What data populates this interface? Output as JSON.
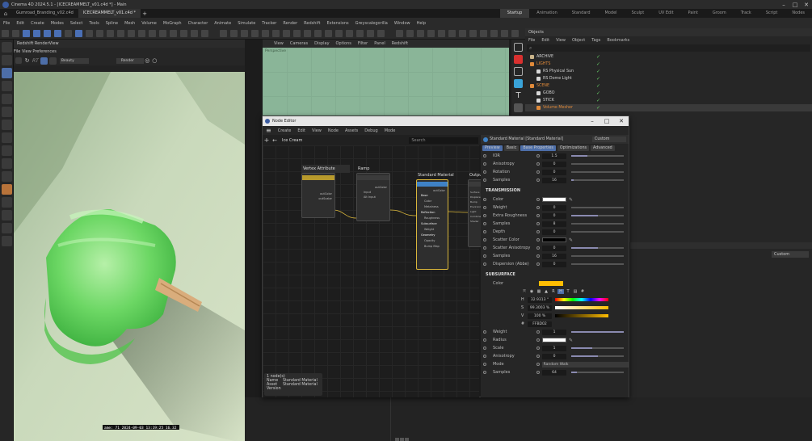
{
  "window": {
    "title": "Cinema 4D 2024.5.1 - [ICECREAMMELT_v01.c4d *] - Main"
  },
  "tabs": [
    {
      "label": "Gumroad_Branding_v02.c4d"
    },
    {
      "label": "ICECREAMMELT_v01.c4d *"
    }
  ],
  "layouts": [
    "Startup",
    "Animation",
    "Standard",
    "Model",
    "Sculpt",
    "UV Edit",
    "Paint",
    "Groom",
    "Track",
    "Script",
    "Nodes"
  ],
  "active_layout": "Startup",
  "menubar": [
    "File",
    "Edit",
    "Create",
    "Modes",
    "Select",
    "Tools",
    "Spline",
    "Mesh",
    "Volume",
    "MoGraph",
    "Character",
    "Animate",
    "Simulate",
    "Tracker",
    "Render",
    "Redshift",
    "Extensions",
    "Greyscalegorilla",
    "Window",
    "Help"
  ],
  "renderview": {
    "title": "Redshift RenderView",
    "menu": "File View Preferences",
    "beauty": "Beauty",
    "render_btn": "Render",
    "status_text": "ame: 71 2024-09-03 13:19:25 16.32"
  },
  "viewport": {
    "menu": [
      "View",
      "Cameras",
      "Display",
      "Options",
      "Filter",
      "Panel",
      "Redshift"
    ],
    "label": "Perspective"
  },
  "objects": {
    "header": "Objects",
    "menu": [
      "File",
      "Edit",
      "View",
      "Object",
      "Tags",
      "Bookmarks"
    ],
    "items": [
      {
        "name": "ARCHIVE",
        "color": "#c9b48a"
      },
      {
        "name": "LIGHTS",
        "color": "#e08a3a"
      },
      {
        "name": "RS Physical Sun",
        "color": "#d8d8d8"
      },
      {
        "name": "RS Dome Light",
        "color": "#d8d8d8"
      },
      {
        "name": "SCENE",
        "color": "#e08a3a"
      },
      {
        "name": "GOBO",
        "color": "#d8d8d8"
      },
      {
        "name": "STICK",
        "color": "#d8d8d8"
      },
      {
        "name": "Volume Mesher",
        "color": "#e08a3a"
      }
    ]
  },
  "node_editor": {
    "title": "Node Editor",
    "menu": [
      "Create",
      "Edit",
      "View",
      "Node",
      "Assets",
      "Debug",
      "Mode"
    ],
    "path": "Ice Cream",
    "search_placeholder": "Search",
    "nodes": [
      {
        "name": "Vertex Attribute",
        "out1": "outColor",
        "out2": "outScalar"
      },
      {
        "name": "Ramp",
        "in1": "Input",
        "in2": "Alt Input",
        "out1": "outColor"
      },
      {
        "name": "Standard Material",
        "out1": "outColor",
        "ports": [
          "Base",
          "Color",
          "Metalness",
          "Reflection",
          "Roughness",
          "Subsurface",
          "Weight",
          "Geometry",
          "Opacity",
          "Bump Map"
        ]
      },
      {
        "name": "Output",
        "ports": [
          "Surface",
          "Displacement",
          "Bump",
          "Environment",
          "Light",
          "Combined",
          "Shader"
        ]
      }
    ],
    "info": {
      "count": "1 node(s)",
      "name_label": "Name",
      "name_value": "Standard Material",
      "asset_label": "Asset",
      "asset_value": "Standard Material",
      "version_label": "Version"
    }
  },
  "attributes": {
    "header": "Standard Material [Standard Material]",
    "mode": "Custom",
    "tabs": [
      "Preview",
      "Basic",
      "Base Properties",
      "Optimizations",
      "Advanced"
    ],
    "top_rows": [
      {
        "label": "IOR",
        "value": "1.5",
        "fill": 0.3
      },
      {
        "label": "Anisotropy",
        "value": "0",
        "fill": 0
      },
      {
        "label": "Rotation",
        "value": "0",
        "fill": 0
      },
      {
        "label": "Samples",
        "value": "16",
        "fill": 0.05
      }
    ],
    "transmission_title": "TRANSMISSION",
    "transmission_rows": [
      {
        "label": "Color",
        "value": "",
        "fill": 0
      },
      {
        "label": "Weight",
        "value": "0",
        "fill": 0
      },
      {
        "label": "Extra Roughness",
        "value": "0",
        "fill": 0.5
      },
      {
        "label": "Samples",
        "value": "8",
        "fill": 0
      },
      {
        "label": "Depth",
        "value": "0",
        "fill": 0
      },
      {
        "label": "Scatter Color",
        "value": "",
        "fill": 0
      },
      {
        "label": "Scatter Anisotropy",
        "value": "0",
        "fill": 0.5
      },
      {
        "label": "Samples",
        "value": "16",
        "fill": 0
      },
      {
        "label": "Dispersion (Abbe)",
        "value": "0",
        "fill": 0
      }
    ],
    "subsurface_title": "SUBSURFACE",
    "subsurface_color_label": "Color",
    "color_picker": {
      "h_label": "H",
      "h_value": "32.9313 °",
      "s_label": "S",
      "s_value": "99.3003 %",
      "v_label": "V",
      "v_value": "100 %",
      "hex_label": "#",
      "hex_value": "FFBD02"
    },
    "subsurface_rows": [
      {
        "label": "Weight",
        "value": "1",
        "fill": 1
      },
      {
        "label": "Radius",
        "value": "",
        "fill": 0
      },
      {
        "label": "Scale",
        "value": "1",
        "fill": 0.4
      },
      {
        "label": "Anisotropy",
        "value": "0",
        "fill": 0.5
      },
      {
        "label": "Mode",
        "value": "Random Walk",
        "fill": 0
      },
      {
        "label": "Samples",
        "value": "64",
        "fill": 0.1
      }
    ]
  },
  "right_lower": {
    "mode": "Custom"
  },
  "colors": {
    "accent": "#4d6ea8",
    "subsurface": "#ffbd02",
    "render_bg": "#c8d9ba",
    "popsicle": "#6fd46a"
  }
}
